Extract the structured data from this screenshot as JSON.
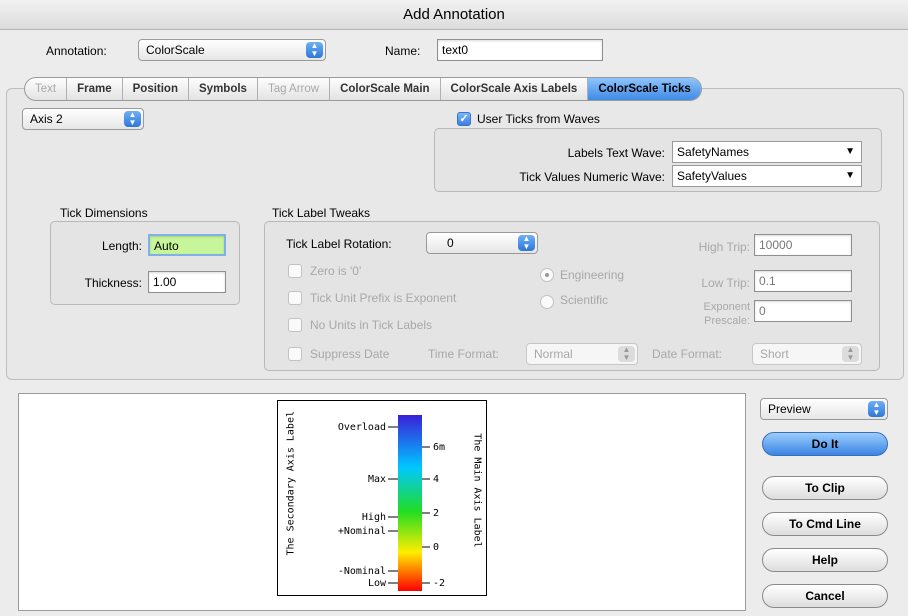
{
  "window": {
    "title": "Add Annotation"
  },
  "header": {
    "annotation_label": "Annotation:",
    "annotation_value": "ColorScale",
    "name_label": "Name:",
    "name_value": "text0"
  },
  "tabs": [
    {
      "label": "Text",
      "enabled": false
    },
    {
      "label": "Frame",
      "enabled": true
    },
    {
      "label": "Position",
      "enabled": true
    },
    {
      "label": "Symbols",
      "enabled": true
    },
    {
      "label": "Tag Arrow",
      "enabled": false
    },
    {
      "label": "ColorScale Main",
      "enabled": true
    },
    {
      "label": "ColorScale Axis Labels",
      "enabled": true
    },
    {
      "label": "ColorScale Ticks",
      "enabled": true,
      "active": true
    }
  ],
  "axis_popup": "Axis 2",
  "user_ticks": {
    "checkbox_label": "User Ticks from Waves",
    "checked": true,
    "labels_wave_label": "Labels Text Wave:",
    "labels_wave_value": "SafetyNames",
    "values_wave_label": "Tick Values Numeric Wave:",
    "values_wave_value": "SafetyValues"
  },
  "tick_dimensions": {
    "title": "Tick Dimensions",
    "length_label": "Length:",
    "length_value": "Auto",
    "thickness_label": "Thickness:",
    "thickness_value": "1.00"
  },
  "tick_label_tweaks": {
    "title": "Tick Label Tweaks",
    "rotation_label": "Tick Label Rotation:",
    "rotation_value": "0",
    "zero_is_0": "Zero is '0'",
    "unit_prefix": "Tick Unit Prefix is Exponent",
    "no_units": "No Units in Tick Labels",
    "suppress_date": "Suppress Date",
    "engineering": "Engineering",
    "scientific": "Scientific",
    "high_trip_label": "High Trip:",
    "high_trip_value": "10000",
    "low_trip_label": "Low Trip:",
    "low_trip_value": "0.1",
    "exponent_label_1": "Exponent",
    "exponent_label_2": "Prescale:",
    "exponent_value": "0",
    "time_format_label": "Time Format:",
    "time_format_value": "Normal",
    "date_format_label": "Date Format:",
    "date_format_value": "Short"
  },
  "colorscale_preview": {
    "left_axis_label": "The Secondary Axis Label",
    "right_axis_label": "The Main Axis Label",
    "left_ticks": [
      "Overload",
      "Max",
      "High",
      "+Nominal",
      "-Nominal",
      "Low"
    ],
    "right_ticks": [
      "6m",
      "4",
      "2",
      "0",
      "-2"
    ],
    "colors": [
      "#3a1fd8",
      "#00c8ff",
      "#22dd22",
      "#ffee00",
      "#ff0000"
    ]
  },
  "buttons": {
    "preview_popup": "Preview",
    "do_it": "Do It",
    "to_clip": "To Clip",
    "to_cmd_line": "To Cmd Line",
    "help": "Help",
    "cancel": "Cancel"
  }
}
